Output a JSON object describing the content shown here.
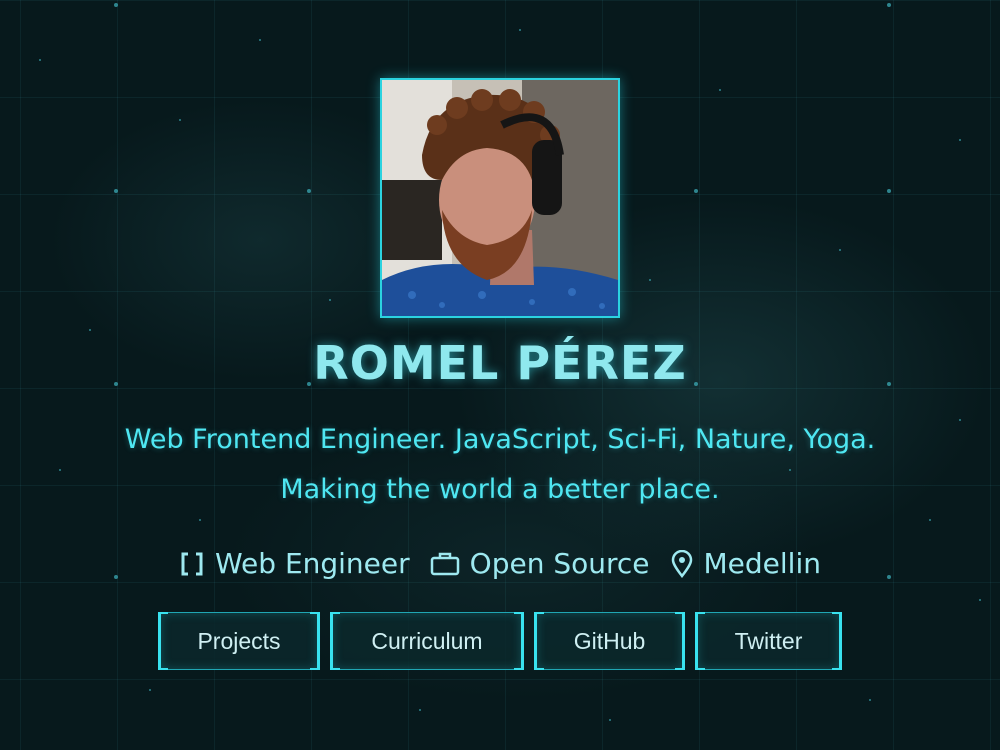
{
  "profile": {
    "name": "ROMEL PÉREZ",
    "bio_line1": "Web Frontend Engineer. JavaScript, Sci-Fi, Nature, Yoga.",
    "bio_line2": "Making the world a better place.",
    "avatar_alt": "portrait-photo"
  },
  "meta": [
    {
      "icon": "brackets-icon",
      "label": "Web Engineer"
    },
    {
      "icon": "briefcase-icon",
      "label": "Open Source"
    },
    {
      "icon": "location-pin-icon",
      "label": "Medellin"
    }
  ],
  "buttons": {
    "projects": "Projects",
    "curriculum": "Curriculum",
    "github": "GitHub",
    "twitter": "Twitter"
  },
  "colors": {
    "accent": "#2bd3e0",
    "text": "#4fe7f2",
    "background": "#07191c"
  }
}
